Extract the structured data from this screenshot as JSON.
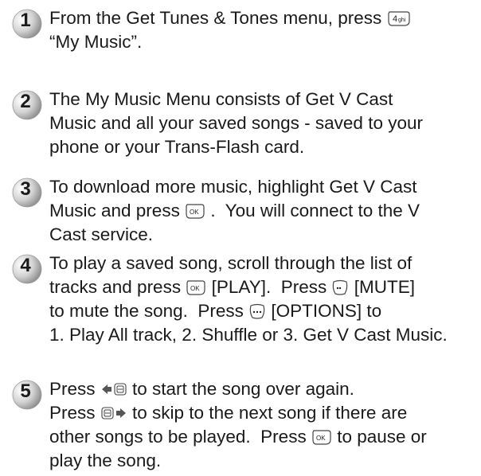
{
  "steps": [
    {
      "number": "1",
      "segments": [
        {
          "t": "From the Get Tunes & Tones menu, press "
        },
        {
          "key": "4-ghi-key-icon"
        },
        {
          "t": "\n“My Music”."
        }
      ]
    },
    {
      "number": "2",
      "segments": [
        {
          "t": "The My Music Menu consists of Get V Cast\nMusic and all your saved songs - saved to your\nphone or your Trans-Flash card."
        }
      ]
    },
    {
      "number": "3",
      "segments": [
        {
          "t": "To download more music, highlight Get V Cast\nMusic and press "
        },
        {
          "key": "ok-key-icon"
        },
        {
          "t": " .  You will connect to the V\nCast service."
        }
      ]
    },
    {
      "number": "4",
      "segments": [
        {
          "t": "To play a saved song, scroll through the list of\ntracks and press "
        },
        {
          "key": "ok-key-icon"
        },
        {
          "t": " [PLAY].  Press "
        },
        {
          "key": "left-soft-key-icon"
        },
        {
          "t": " [MUTE]\nto mute the song.  Press "
        },
        {
          "key": "right-soft-key-icon"
        },
        {
          "t": " [OPTIONS] to\n1. Play All track, 2. Shuffle or 3. Get V Cast Music."
        }
      ]
    },
    {
      "number": "5",
      "segments": [
        {
          "t": "Press "
        },
        {
          "key": "nav-left-key-icon"
        },
        {
          "t": " to start the song over again.\nPress "
        },
        {
          "key": "nav-right-key-icon"
        },
        {
          "t": " to skip to the next song if there are\nother songs to be played.  Press "
        },
        {
          "key": "ok-key-icon"
        },
        {
          "t": " to pause or\nplay the song."
        }
      ]
    }
  ],
  "colors": {
    "badge_light": "#f4f4f4",
    "badge_dark": "#8a8a8a",
    "text": "#1a1a1a"
  }
}
